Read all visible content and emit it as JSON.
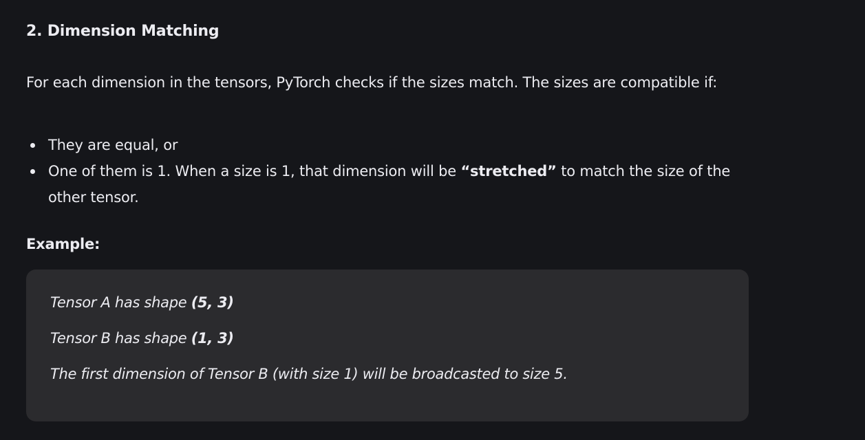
{
  "section": {
    "heading": "2. Dimension Matching",
    "intro": "For each dimension in the tensors, PyTorch checks if the sizes match. The sizes are compatible if:",
    "bullets": [
      {
        "text": "They are equal, or"
      },
      {
        "before": "One of them is 1. When a size is 1, that dimension will be ",
        "bold": "“stretched”",
        "after": " to match the size of the other tensor."
      }
    ],
    "example_label": "Example:",
    "example": {
      "line1_text": "Tensor A has shape ",
      "line1_shape": "(5, 3)",
      "line2_text": "Tensor B has shape ",
      "line2_shape": "(1, 3)",
      "line3_text": "The first dimension of Tensor B (with size 1) will be broadcasted to size 5."
    }
  },
  "colors": {
    "background": "#15161a",
    "text": "#ececf1",
    "quote_background": "#2b2b2e"
  }
}
